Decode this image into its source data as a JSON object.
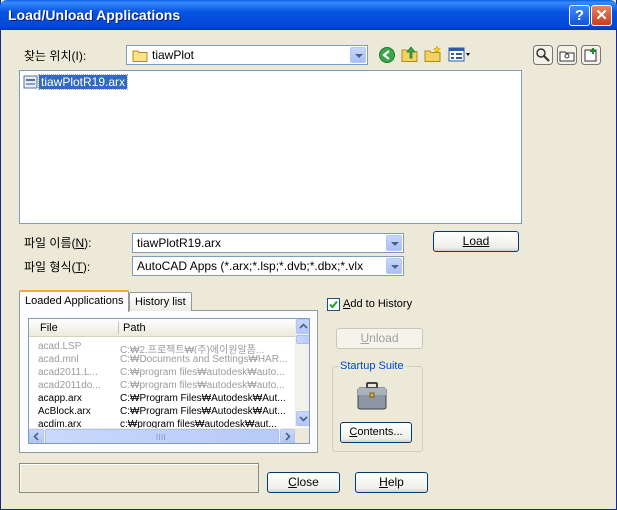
{
  "window": {
    "title": "Load/Unload Applications",
    "help_glyph": "?",
    "close_glyph": "✕"
  },
  "lookin": {
    "label": "찾는 위치(I):",
    "value": "tiawPlot"
  },
  "file_list": {
    "items": [
      "tiawPlotR19.arx"
    ]
  },
  "filename": {
    "label": "파일 이름(N):",
    "value": "tiawPlotR19.arx"
  },
  "filetype": {
    "label": "파일 형식(T):",
    "value": "AutoCAD Apps (*.arx;*.lsp;*.dvb;*.dbx;*.vlx"
  },
  "buttons": {
    "load": "Load",
    "unload": "Unload",
    "contents": "Contents...",
    "close": "Close",
    "help": "Help"
  },
  "tabs": [
    "Loaded Applications",
    "History list"
  ],
  "add_to_history": {
    "label": "Add to History",
    "checked": true
  },
  "startup_suite": {
    "title": "Startup Suite"
  },
  "loaded_apps": {
    "columns": [
      "File",
      "Path"
    ],
    "rows": [
      {
        "file": "acad.LSP",
        "path": "C:₩2.프로젝트₩(주)에이원알폼...",
        "gray": true
      },
      {
        "file": "acad.mnl",
        "path": "C:₩Documents and Settings₩HAR...",
        "gray": true
      },
      {
        "file": "acad2011.L...",
        "path": "C:₩program files₩autodesk₩auto...",
        "gray": true
      },
      {
        "file": "acad2011do...",
        "path": "C:₩program files₩autodesk₩auto...",
        "gray": true
      },
      {
        "file": "acapp.arx",
        "path": "C:₩Program Files₩Autodesk₩Aut...",
        "gray": false
      },
      {
        "file": "AcBlock.arx",
        "path": "C:₩Program Files₩Autodesk₩Aut...",
        "gray": false
      },
      {
        "file": "acdim.arx",
        "path": "c:₩program files₩autodesk₩aut...",
        "gray": false
      }
    ]
  },
  "colors": {
    "title_bar": "#0754e2",
    "selection": "#316ac5",
    "tab_highlight": "#f1a93b",
    "group_title": "#0046d5"
  }
}
